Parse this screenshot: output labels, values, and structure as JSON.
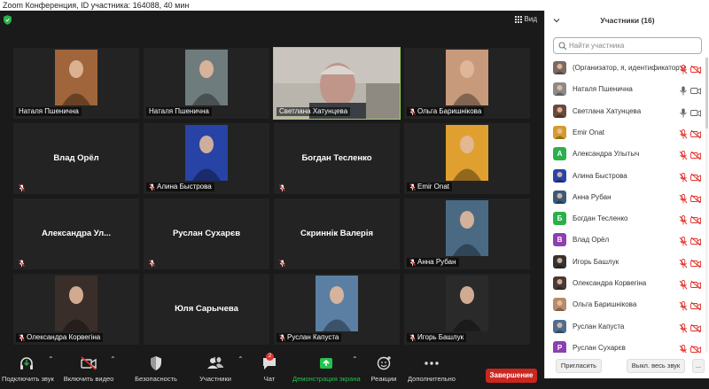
{
  "window": {
    "title": "Zoom Конференция, ID участника: 164088, 40 мин"
  },
  "topbar": {
    "view_label": "Вид"
  },
  "tiles": [
    {
      "name": "Наталя Пшенична",
      "big_name": "",
      "muted": false,
      "has_photo": true,
      "photo_color": "#a0653a"
    },
    {
      "name": "Наталя Пшенична",
      "big_name": "",
      "muted": false,
      "has_photo": true,
      "photo_color": "#6f7c7e"
    },
    {
      "name": "Светлана Хатунцева",
      "big_name": "",
      "muted": false,
      "has_photo": false,
      "active": true
    },
    {
      "name": "Ольга Баришнікова",
      "big_name": "",
      "muted": true,
      "has_photo": true,
      "photo_color": "#c89a7c"
    },
    {
      "name": "",
      "big_name": "Влад Орёл",
      "muted": true,
      "has_photo": false
    },
    {
      "name": "Алина Быстрова",
      "big_name": "",
      "muted": true,
      "has_photo": true,
      "photo_color": "#2743a6"
    },
    {
      "name": "",
      "big_name": "Богдан Тесленко",
      "muted": true,
      "has_photo": false
    },
    {
      "name": "Emir Onat",
      "big_name": "",
      "muted": true,
      "has_photo": true,
      "photo_color": "#e0a030"
    },
    {
      "name": "",
      "big_name": "Александра  Ул...",
      "muted": true,
      "has_photo": false
    },
    {
      "name": "",
      "big_name": "Руслан Сухарєв",
      "muted": true,
      "has_photo": false
    },
    {
      "name": "",
      "big_name": "Скриннік Валерія",
      "muted": true,
      "has_photo": false
    },
    {
      "name": "Анна Рубан",
      "big_name": "",
      "muted": true,
      "has_photo": true,
      "photo_color": "#4a6a84"
    },
    {
      "name": "Олександра Корвегіна",
      "big_name": "",
      "muted": true,
      "has_photo": true,
      "photo_color": "#3a2e2a"
    },
    {
      "name": "",
      "big_name": "Юля Сарычева",
      "muted": false,
      "has_photo": false
    },
    {
      "name": "Руслан Капуста",
      "big_name": "",
      "muted": true,
      "has_photo": true,
      "photo_color": "#5a7fa3"
    },
    {
      "name": "Игорь Башлук",
      "big_name": "",
      "muted": true,
      "has_photo": true,
      "photo_color": "#2a2a2a"
    }
  ],
  "toolbar": {
    "audio_label": "Подключить звук",
    "video_label": "Включить видео",
    "security_label": "Безопасность",
    "participants_label": "Участники",
    "participants_count": "16",
    "chat_label": "Чат",
    "chat_badge": "2",
    "share_label": "Демонстрация экрана",
    "reactions_label": "Реакции",
    "more_label": "Дополнительно",
    "leave_label": "Завершение",
    "share_color": "#23c24e",
    "leave_color": "#c9271f"
  },
  "panel": {
    "title": "Участники (16)",
    "search_placeholder": "Найти участника",
    "participants": [
      {
        "name": " (Организатор, я, идентификатор уча",
        "avatar": "photo",
        "color": "#7a6a60",
        "state": "muted-novideo"
      },
      {
        "name": "Наталя Пшенична",
        "avatar": "photo",
        "color": "#8a8a8a",
        "state": "mic-video"
      },
      {
        "name": "Светлана Хатунцева",
        "avatar": "photo",
        "color": "#6a4a3a",
        "state": "mic-video"
      },
      {
        "name": "Emir Onat",
        "avatar": "photo",
        "color": "#d49b2c",
        "state": "muted-novideo"
      },
      {
        "name": "Александра Улытыч",
        "avatar": "letter",
        "letter": "А",
        "color": "#2bb04a",
        "state": "muted-novideo"
      },
      {
        "name": "Алина Быстрова",
        "avatar": "photo",
        "color": "#2a44a8",
        "state": "muted-novideo"
      },
      {
        "name": "Анна Рубан",
        "avatar": "photo",
        "color": "#3c5a7a",
        "state": "muted-novideo"
      },
      {
        "name": "Богдан Тесленко",
        "avatar": "letter",
        "letter": "Б",
        "color": "#2bb04a",
        "state": "muted-novideo"
      },
      {
        "name": "Влад Орёл",
        "avatar": "letter",
        "letter": "В",
        "color": "#8e3fb0",
        "state": "muted-novideo"
      },
      {
        "name": "Игорь Башлук",
        "avatar": "photo",
        "color": "#333333",
        "state": "muted-novideo"
      },
      {
        "name": "Олександра Корвегіна",
        "avatar": "photo",
        "color": "#4a3a32",
        "state": "muted-novideo"
      },
      {
        "name": "Ольга Баришнікова",
        "avatar": "photo",
        "color": "#b88a6a",
        "state": "muted-novideo"
      },
      {
        "name": "Руслан Капуста",
        "avatar": "photo",
        "color": "#4f6e8f",
        "state": "muted-novideo"
      },
      {
        "name": "Руслан Сухарєв",
        "avatar": "letter",
        "letter": "Р",
        "color": "#8e3fb0",
        "state": "muted-novideo"
      }
    ],
    "invite_label": "Пригласить",
    "mute_all_label": "Выкл. весь звук",
    "more_label": "..."
  }
}
